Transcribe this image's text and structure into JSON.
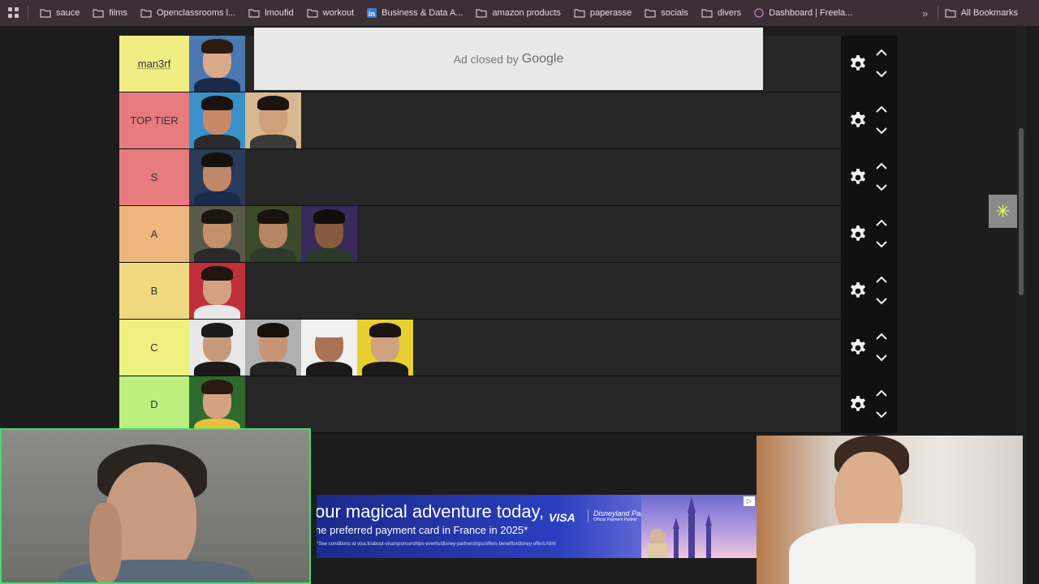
{
  "bookmarks": {
    "items": [
      {
        "label": "sauce",
        "icon": "folder-icon"
      },
      {
        "label": "films",
        "icon": "folder-icon"
      },
      {
        "label": "Openclassrooms l...",
        "icon": "folder-icon"
      },
      {
        "label": "lmoufid",
        "icon": "folder-icon"
      },
      {
        "label": "workout",
        "icon": "folder-icon"
      },
      {
        "label": "Business & Data A...",
        "icon": "linkedin-icon"
      },
      {
        "label": "amazon products",
        "icon": "folder-icon"
      },
      {
        "label": "paperasse",
        "icon": "folder-icon"
      },
      {
        "label": "socials",
        "icon": "folder-icon"
      },
      {
        "label": "divers",
        "icon": "folder-icon"
      },
      {
        "label": "Dashboard | Freela...",
        "icon": "fiverr-icon"
      }
    ],
    "more": "»",
    "all_label": "All Bookmarks"
  },
  "ad_top": {
    "text": "Ad closed by",
    "brand": "Google"
  },
  "tiers": [
    {
      "label": "man3rf",
      "color": "#f2ed82",
      "count": 1
    },
    {
      "label": "TOP TIER",
      "color": "#e77b7d",
      "count": 2
    },
    {
      "label": "S",
      "color": "#e77b7d",
      "count": 1
    },
    {
      "label": "A",
      "color": "#edb67d",
      "count": 3
    },
    {
      "label": "B",
      "color": "#f1d97f",
      "count": 1
    },
    {
      "label": "C",
      "color": "#eef07f",
      "count": 4
    },
    {
      "label": "D",
      "color": "#bcef7d",
      "count": 1
    }
  ],
  "controls": {
    "up": "⌃",
    "down": "⌄"
  },
  "bottom_ad": {
    "headline": "our magical adventure today,",
    "subline": "he preferred payment card in France in 2025*",
    "fine": "*See conditions at visa.fr/about-visa/sponsorships-events/disney-partnerships/offers-benefits/disney-offers.html",
    "visa": "VISA",
    "disney": "Disneyland Paris",
    "disney_note": "Official Payment Partner"
  }
}
